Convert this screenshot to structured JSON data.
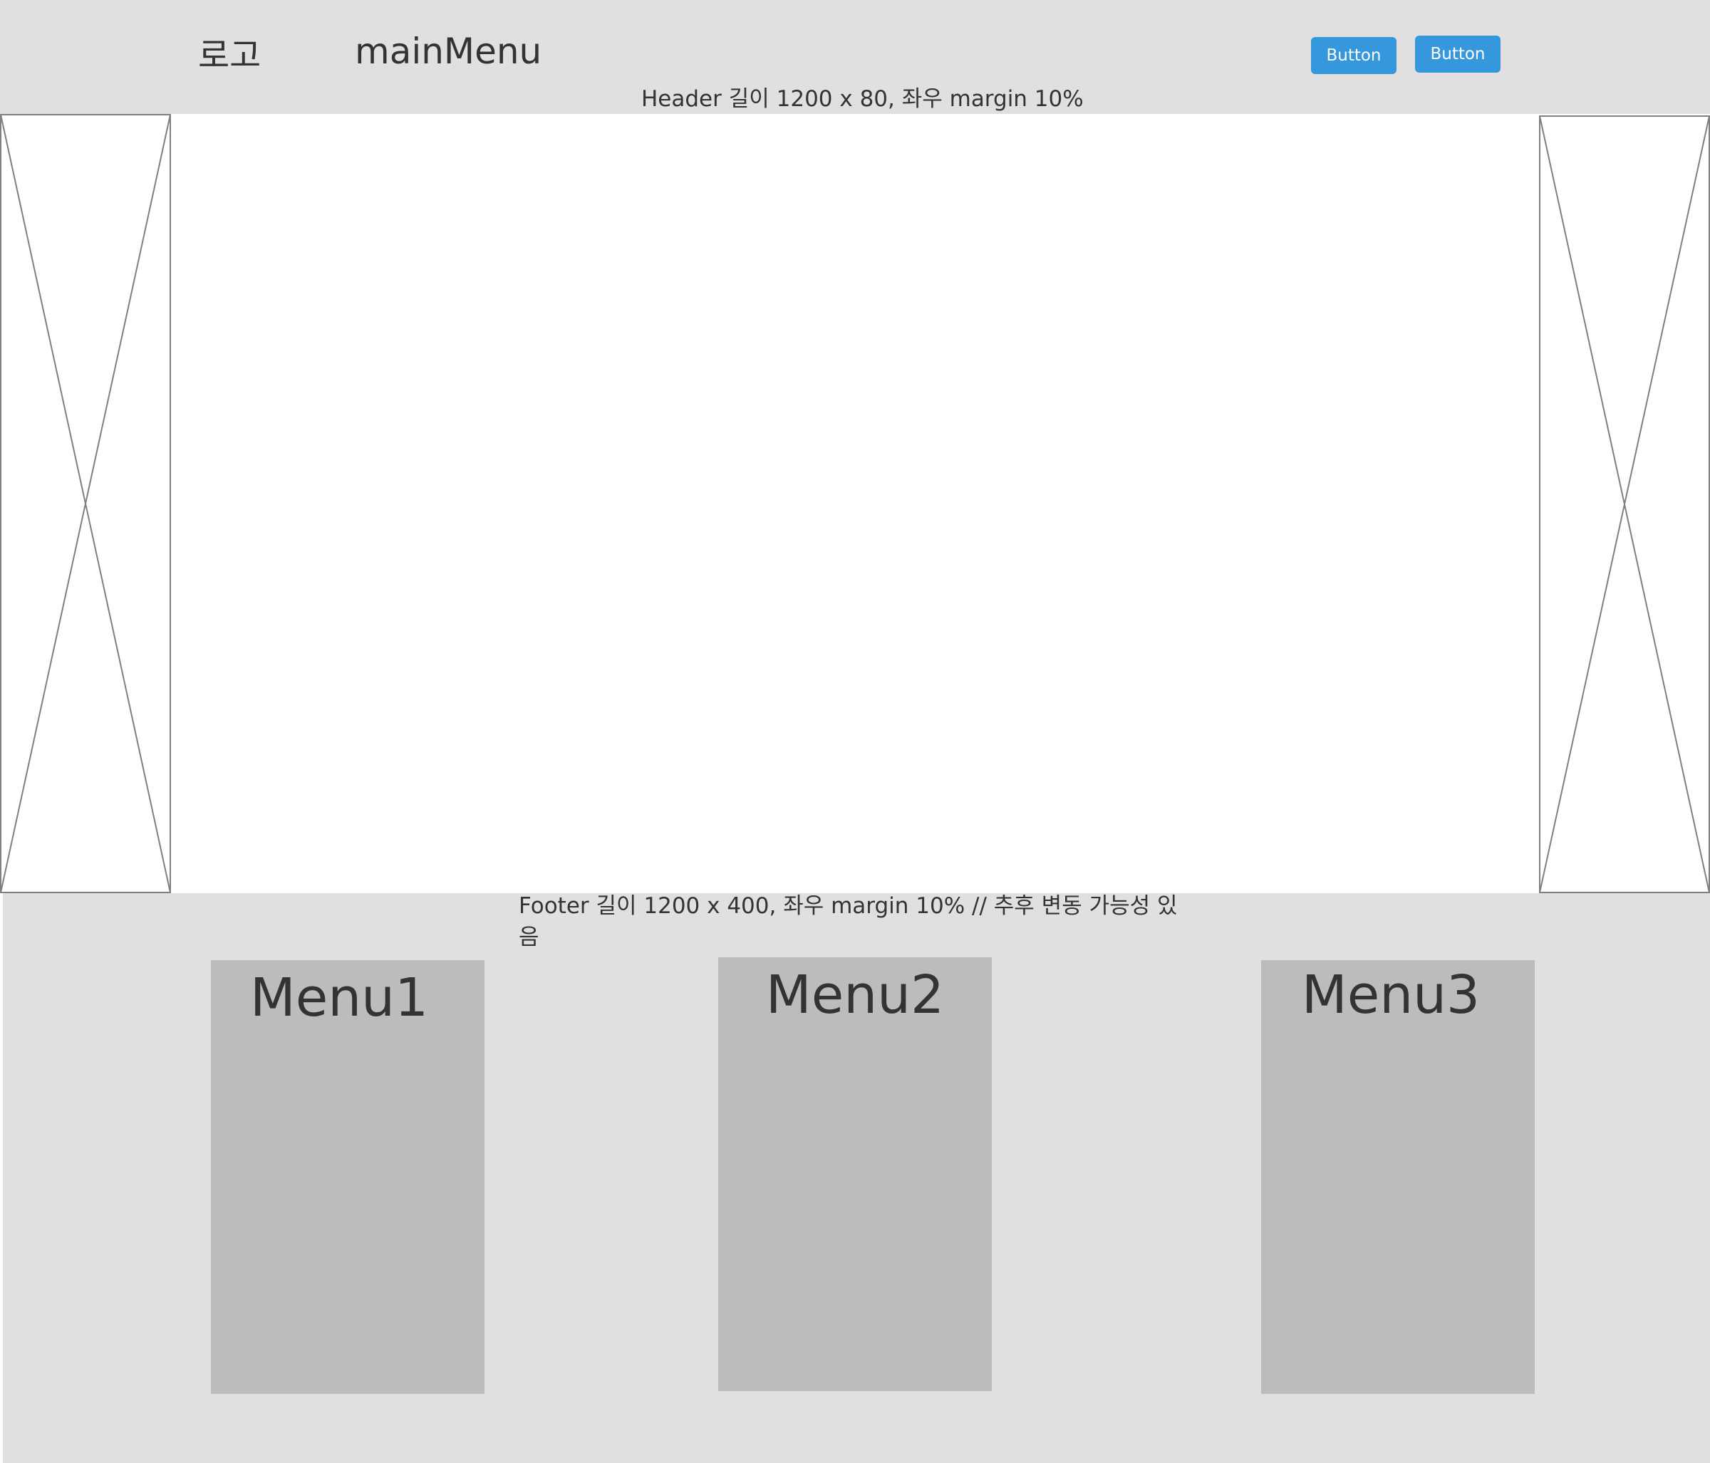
{
  "header": {
    "logo": "로고",
    "main_menu": "mainMenu",
    "buttons": [
      "Button",
      "Button"
    ],
    "note": "Header 길이 1200 x 80, 좌우 margin 10%"
  },
  "side_images": {
    "left": "image-placeholder",
    "right": "image-placeholder"
  },
  "footer": {
    "note": "Footer  길이 1200 x 400, 좌우 margin 10% // 추후 변동 가능성 있음",
    "menus": [
      "Menu1",
      "Menu2",
      "Menu3"
    ]
  },
  "colors": {
    "header_bg": "#e0e0e0",
    "footer_bg": "#e0e0e0",
    "menu_card_bg": "#bcbcbc",
    "button_bg": "#3597dc",
    "text": "#333333"
  }
}
